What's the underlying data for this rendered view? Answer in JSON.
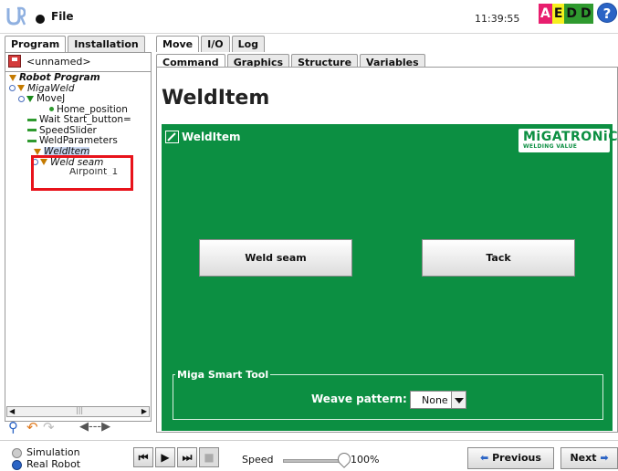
{
  "topbar": {
    "file_label": "File",
    "clock": "11:39:55",
    "aedd": [
      {
        "letter": "A",
        "bg": "#e81e6e",
        "fg": "#ffffff"
      },
      {
        "letter": "E",
        "bg": "#f5f01e",
        "fg": "#111111"
      },
      {
        "letter": "D",
        "bg": "#2f9a2f",
        "fg": "#111111"
      },
      {
        "letter": "D",
        "bg": "#2f9a2f",
        "fg": "#111111"
      }
    ],
    "help_label": "?"
  },
  "main_tabs": [
    "Program",
    "Installation",
    "Move",
    "I/O",
    "Log"
  ],
  "sub_tabs": [
    "Command",
    "Graphics",
    "Structure",
    "Variables"
  ],
  "program": {
    "name": "<unnamed>"
  },
  "tree": {
    "root": "Robot Program",
    "miga_weld": "MigaWeld",
    "movej": "MoveJ",
    "home": "Home_position",
    "wait": "Wait Start_button=",
    "speed_slider": "SpeedSlider",
    "weld_params": "WeldParameters",
    "weld_item": "WeldItem",
    "weld_seam": "Weld seam",
    "airpoint": "Airpoint_1"
  },
  "page": {
    "title": "WeldItem",
    "panel_header": "WeldItem",
    "brand_main": "MiGATRONiC",
    "brand_sub": "WELDING VALUE",
    "weld_seam_button": "Weld seam",
    "tack_button": "Tack",
    "smart_tool_legend": "Miga Smart Tool",
    "weave_label": "Weave pattern:",
    "weave_value": "None"
  },
  "colors": {
    "panel_green": "#0c8f42",
    "highlight_red": "#e8131b"
  },
  "bottom": {
    "simulation": "Simulation",
    "real_robot": "Real Robot",
    "speed_label": "Speed",
    "speed_value": "100%",
    "speed_fraction": 1.0,
    "previous": "Previous",
    "next": "Next"
  }
}
